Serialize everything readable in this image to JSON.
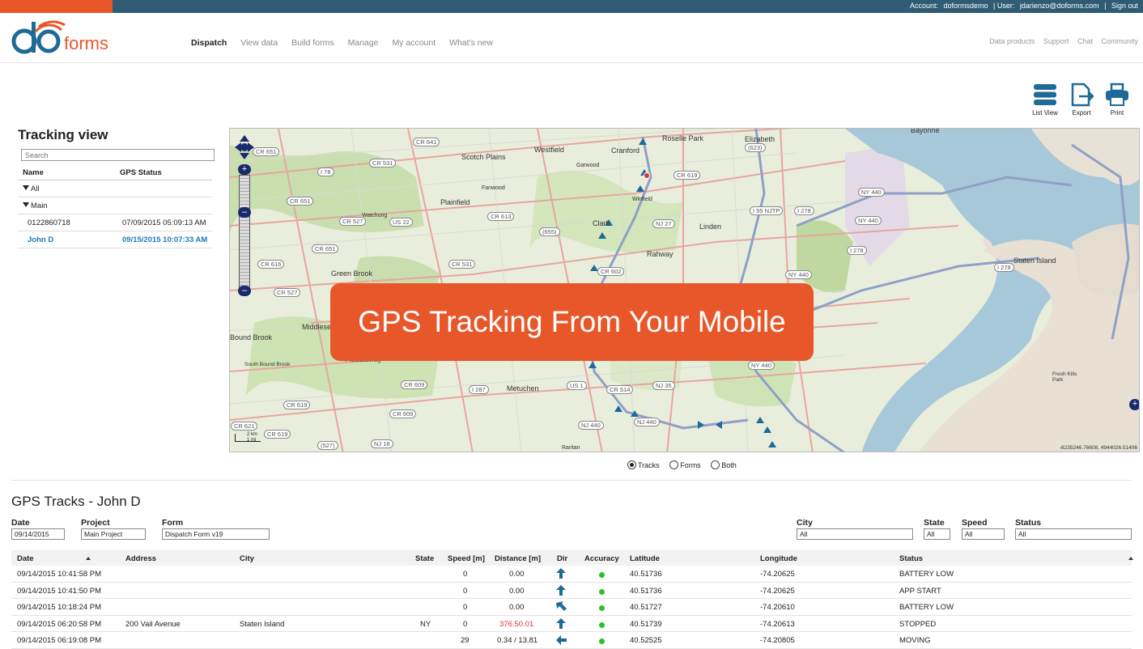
{
  "topbar": {
    "account_label": "Account:",
    "account_value": "doformsdemo",
    "user_label": "| User:",
    "user_value": "jdarienzo@doforms.com",
    "divider": "|",
    "signout": "Sign out",
    "accent_color": "#e8572a",
    "bar_color": "#2f5c74"
  },
  "logo": {
    "text": "forms",
    "mark": "do"
  },
  "nav": [
    {
      "label": "Dispatch",
      "active": true
    },
    {
      "label": "View data"
    },
    {
      "label": "Build forms"
    },
    {
      "label": "Manage"
    },
    {
      "label": "My account"
    },
    {
      "label": "What's new"
    }
  ],
  "rightnav": [
    "Data products",
    "Support",
    "Chat",
    "Community"
  ],
  "tools": [
    {
      "label": "List View",
      "icon": "list-view-icon"
    },
    {
      "label": "Export",
      "icon": "export-icon"
    },
    {
      "label": "Print",
      "icon": "print-icon"
    }
  ],
  "tracking": {
    "title": "Tracking view",
    "search_placeholder": "Search",
    "col_name": "Name",
    "col_status": "GPS Status",
    "rows": [
      {
        "name": "All",
        "status": ""
      },
      {
        "name": "Main",
        "status": ""
      },
      {
        "name": "0122860718",
        "status": "07/09/2015 05:09:13 AM"
      },
      {
        "name": "John D",
        "status": "09/15/2015 10:07:33 AM"
      }
    ]
  },
  "map": {
    "banner": "GPS Tracking From Your Mobile",
    "coords": "-8235246.76608, 4944026.51406",
    "scale_top": "2 km",
    "scale_bottom": "1 mi",
    "labels": [
      "Bayonne",
      "Roselle Park",
      "Elizabeth",
      "Scotch Plains",
      "Westfield",
      "Cranford",
      "Garwood",
      "Fanwood",
      "Winfield",
      "Watchung",
      "Plainfield",
      "Clark",
      "Linden",
      "Rahway",
      "Green Brook",
      "Middlesex",
      "Bound Brook",
      "South Bound Brook",
      "Piscataway",
      "Metuchen",
      "Staten Island",
      "Fresh Kills Park",
      "Raritan"
    ],
    "shields": [
      "CR 651",
      "CR 531",
      "CR 641",
      "I 78",
      "CR 651",
      "CR 527",
      "US 22",
      "CR 613",
      "(655)",
      "CR 619",
      "CR 616",
      "CR 651",
      "CR 527",
      "CR 531",
      "CR 602",
      "NJ 27",
      "I 95 NJTP",
      "I 278",
      "NY 440",
      "NY 440",
      "I 278",
      "I 278",
      "NY 440",
      "NY 440",
      "CR 609",
      "I 287",
      "CR 609",
      "CR 514",
      "NJ 35",
      "US 1",
      "NJ 440",
      "NJ 440",
      "CR 619",
      "CR 621",
      "CR 619",
      "(527)",
      "NJ 18",
      "(623)"
    ]
  },
  "view_toggle": {
    "options": [
      {
        "label": "Tracks",
        "checked": true
      },
      {
        "label": "Forms",
        "checked": false
      },
      {
        "label": "Both",
        "checked": false
      }
    ]
  },
  "gps": {
    "title": "GPS Tracks - John D",
    "filters": {
      "date": {
        "label": "Date",
        "value": "09/14/2015"
      },
      "project": {
        "label": "Project",
        "value": "Main Project"
      },
      "form": {
        "label": "Form",
        "value": "Dispatch Form v19"
      },
      "city": {
        "label": "City",
        "value": "All"
      },
      "state": {
        "label": "State",
        "value": "All"
      },
      "speed": {
        "label": "Speed",
        "value": "All"
      },
      "status": {
        "label": "Status",
        "value": "All"
      }
    },
    "columns": [
      "Date",
      "Address",
      "City",
      "State",
      "Speed [m]",
      "Distance [m]",
      "Dir",
      "Accuracy",
      "Latitude",
      "Longitude",
      "Status"
    ],
    "rows": [
      {
        "date": "09/14/2015 10:41:58 PM",
        "address": "",
        "city": "",
        "state": "",
        "speed": "0",
        "distance": "0.00",
        "dir": "up",
        "lat": "40.51736",
        "lon": "-74.20625",
        "status": "BATTERY LOW"
      },
      {
        "date": "09/14/2015 10:41:50 PM",
        "address": "",
        "city": "",
        "state": "",
        "speed": "0",
        "distance": "0.00",
        "dir": "up",
        "lat": "40.51736",
        "lon": "-74.20625",
        "status": "APP START"
      },
      {
        "date": "09/14/2015 10:18:24 PM",
        "address": "",
        "city": "",
        "state": "",
        "speed": "0",
        "distance": "0.00",
        "dir": "nw",
        "lat": "40.51727",
        "lon": "-74.20610",
        "status": "BATTERY LOW"
      },
      {
        "date": "09/14/2015 06:20:58 PM",
        "address": "200 Vail Avenue",
        "city": "Staten Island",
        "state": "NY",
        "speed": "0",
        "distance": "376.50.01",
        "dir": "up",
        "lat": "40.51739",
        "lon": "-74.20613",
        "status": "STOPPED"
      },
      {
        "date": "09/14/2015 06:19:08 PM",
        "address": "",
        "city": "",
        "state": "",
        "speed": "29",
        "distance": "0.34 / 13.81",
        "dir": "left",
        "lat": "40.52525",
        "lon": "-74.20805",
        "status": "MOVING"
      }
    ]
  }
}
